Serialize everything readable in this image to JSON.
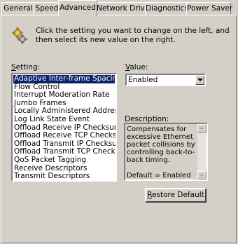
{
  "tabs": [
    {
      "label": "General",
      "active": false
    },
    {
      "label": "Speed",
      "active": false
    },
    {
      "label": "Advanced",
      "active": true
    },
    {
      "label": "Network Driver",
      "active": false
    },
    {
      "label": "Diagnostics",
      "active": false
    },
    {
      "label": "Power Saver",
      "active": false
    }
  ],
  "intro": {
    "icon": "gear-icon",
    "text": "Click the setting you want to change on the left, and then select its new value on the right."
  },
  "setting": {
    "label_first": "S",
    "label_rest": "etting:",
    "selected_index": 0,
    "items": [
      "Adaptive Inter-frame Spacing",
      "Flow Control",
      "Interrupt Moderation Rate",
      "Jumbo Frames",
      "Locally Administered Address",
      "Log Link State Event",
      "Offload Receive IP Checksum",
      "Offload Receive TCP Checksum",
      "Offload Transmit IP Checksum",
      "Offload Transmit TCP Checksum",
      "QoS Packet Tagging",
      "Receive Descriptors",
      "Transmit Descriptors"
    ]
  },
  "value": {
    "label_first": "V",
    "label_rest": "alue:",
    "selected": "Enabled"
  },
  "description": {
    "label": "Description:",
    "text": "Compensates for excessive Ethernet packet collisions by controlling back-to-back timing.",
    "default": "Default = Enabled"
  },
  "restore_button": {
    "label_first": "R",
    "label_rest": "estore Default"
  }
}
